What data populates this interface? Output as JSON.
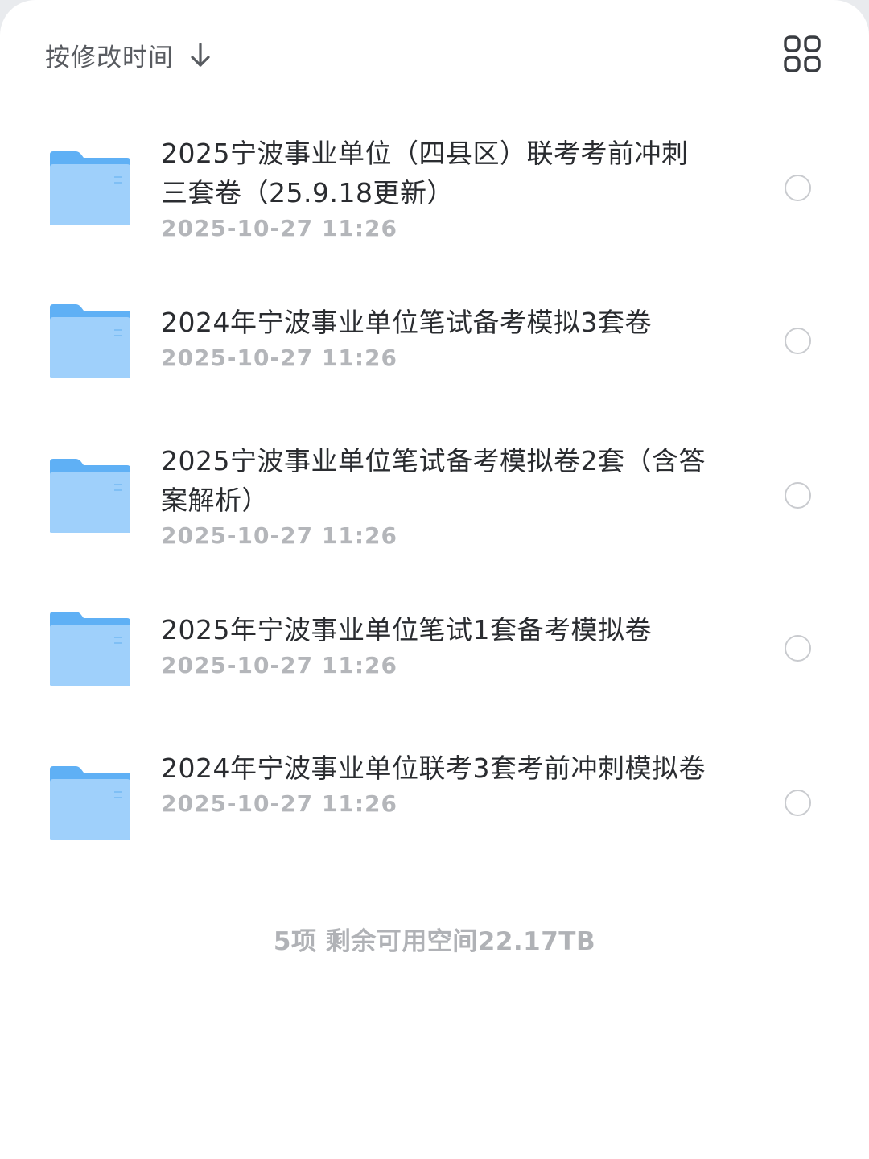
{
  "toolbar": {
    "sort_label": "按修改时间",
    "sort_direction_icon": "arrow-down-icon",
    "view_toggle_icon": "grid-view-icon"
  },
  "colors": {
    "folder": "#5fb0f5",
    "folder_light": "#9fd0fb",
    "name_text": "#2a2c30",
    "time_text": "#b4b6ba",
    "radio_border": "#c9cbcf"
  },
  "files": [
    {
      "name": "2025宁波事业单位（四县区）联考考前冲刺三套卷（25.9.18更新）",
      "modified": "2025-10-27 11:26",
      "icon": "folder-icon",
      "selected": false
    },
    {
      "name": "2024年宁波事业单位笔试备考模拟3套卷",
      "modified": "2025-10-27 11:26",
      "icon": "folder-icon",
      "selected": false
    },
    {
      "name": "2025宁波事业单位笔试备考模拟卷2套（含答案解析）",
      "modified": "2025-10-27 11:26",
      "icon": "folder-icon",
      "selected": false
    },
    {
      "name": "2025年宁波事业单位笔试1套备考模拟卷",
      "modified": "2025-10-27 11:26",
      "icon": "folder-icon",
      "selected": false
    },
    {
      "name": "2024年宁波事业单位联考3套考前冲刺模拟卷",
      "modified": "2025-10-27 11:26",
      "icon": "folder-icon",
      "selected": false
    }
  ],
  "footer": {
    "summary": "5项 剩余可用空间22.17TB"
  }
}
